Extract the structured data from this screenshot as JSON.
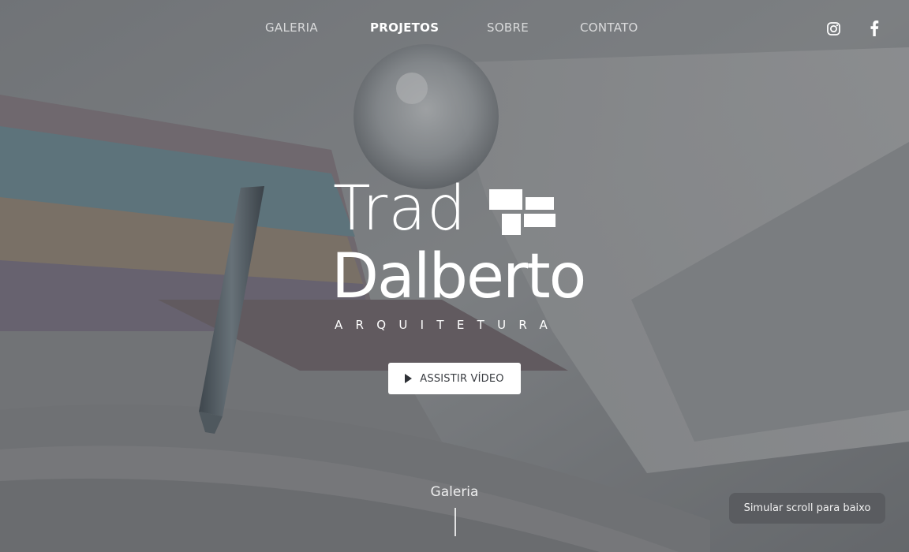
{
  "nav": {
    "items": [
      {
        "label": "GALERIA",
        "active": false
      },
      {
        "label": "PROJETOS",
        "active": true
      },
      {
        "label": "SOBRE",
        "active": false
      },
      {
        "label": "CONTATO",
        "active": false
      }
    ],
    "social": [
      "instagram-icon",
      "facebook-icon"
    ]
  },
  "logo": {
    "line1": "Trad",
    "line2": "Dalberto",
    "line3": "ARQUITETURA"
  },
  "hero": {
    "video_button_label": "ASSISTIR VÍDEO",
    "video_button_icon": "play-icon"
  },
  "scroll_hint": {
    "label": "Galeria"
  },
  "simulate_button": {
    "label": "Simular scroll para baixo"
  },
  "colors": {
    "overlay": "#3c3e42",
    "button_bg": "#ffffff",
    "button_text": "#3a3d42",
    "sim_bg": "#5a5c60"
  }
}
